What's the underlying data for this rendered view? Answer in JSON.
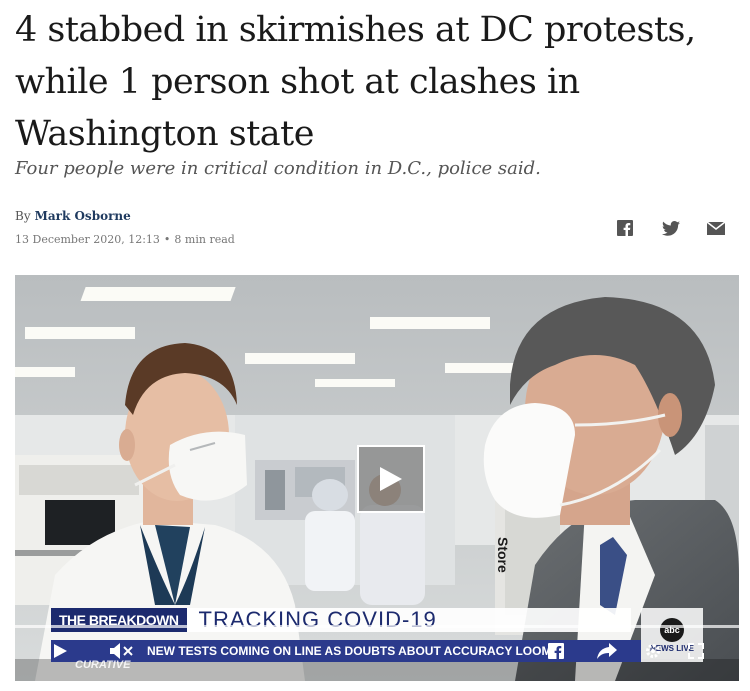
{
  "article": {
    "headline": "4 stabbed in skirmishes at DC protests, while 1 person shot at clashes in Washington state",
    "subheadline": "Four people were in critical condition in D.C., police said.",
    "byline_prefix": "By",
    "author": "Mark Osborne",
    "date": "13 December 2020, 12:13",
    "dot": "•",
    "read_time": "8 min read"
  },
  "share": {
    "icons": [
      "facebook-icon",
      "twitter-icon",
      "mail-icon"
    ]
  },
  "video": {
    "chyron_tag": "THE BREAKDOWN",
    "chyron_title": "TRACKING COVID-19",
    "ticker": "NEW TESTS COMING ON LINE AS DOUBTS ABOUT ACCURACY LOOM",
    "network_logo": "abc",
    "network_bug": "NEWS LIVE",
    "lower_logo": "CURATIVE",
    "background_text": "Store",
    "colors": {
      "chyron_blue": "#1c2a6e",
      "ticker_blue": "#2b3a8c"
    }
  }
}
